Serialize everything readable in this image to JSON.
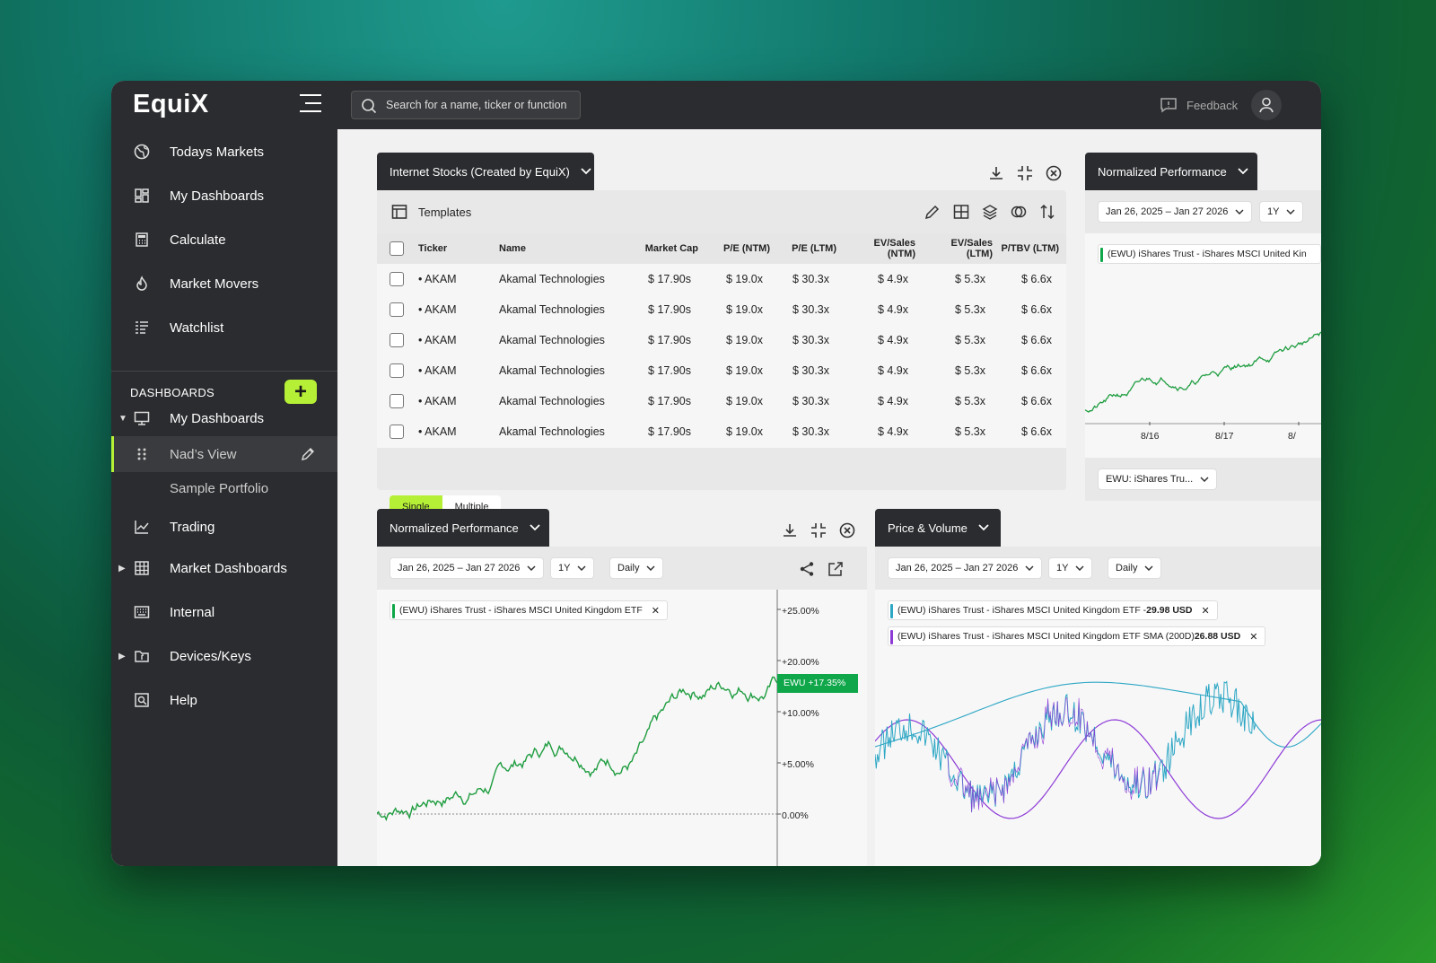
{
  "app": {
    "logo": "EquiX"
  },
  "sidebar": {
    "nav": [
      {
        "label": "Todays Markets",
        "icon": "globe-icon"
      },
      {
        "label": "My Dashboards",
        "icon": "dashboard-grid-icon"
      },
      {
        "label": "Calculate",
        "icon": "calculator-icon"
      },
      {
        "label": "Market Movers",
        "icon": "flame-icon"
      },
      {
        "label": "Watchlist",
        "icon": "list-icon"
      }
    ],
    "dashboards_label": "DASHBOARDS",
    "add_label": "+",
    "dash_items": [
      {
        "label": "My Dashboards"
      },
      {
        "label": "Nad’s View"
      },
      {
        "label": "Sample Portfolio"
      },
      {
        "label": "Trading"
      },
      {
        "label": "Market Dashboards"
      },
      {
        "label": "Internal"
      },
      {
        "label": "Devices/Keys"
      },
      {
        "label": "Help"
      }
    ]
  },
  "topbar": {
    "search_placeholder": "Search for a name, ticker or function",
    "feedback": "Feedback"
  },
  "screener": {
    "title": "Internet Stocks (Created by EquiX)",
    "templates": "Templates",
    "columns": [
      "Ticker",
      "Name",
      "Market Cap",
      "P/E (NTM)",
      "P/E (LTM)",
      "EV/Sales (NTM)",
      "EV/Sales (LTM)",
      "P/TBV (LTM)"
    ],
    "rows": [
      [
        "• AKAM",
        "Akamal Technologies",
        "$ 17.90s",
        "$ 19.0x",
        "$ 30.3x",
        "$ 4.9x",
        "$ 5.3x",
        "$ 6.6x"
      ],
      [
        "• AKAM",
        "Akamal Technologies",
        "$ 17.90s",
        "$ 19.0x",
        "$ 30.3x",
        "$ 4.9x",
        "$ 5.3x",
        "$ 6.6x"
      ],
      [
        "• AKAM",
        "Akamal Technologies",
        "$ 17.90s",
        "$ 19.0x",
        "$ 30.3x",
        "$ 4.9x",
        "$ 5.3x",
        "$ 6.6x"
      ],
      [
        "• AKAM",
        "Akamal Technologies",
        "$ 17.90s",
        "$ 19.0x",
        "$ 30.3x",
        "$ 4.9x",
        "$ 5.3x",
        "$ 6.6x"
      ],
      [
        "• AKAM",
        "Akamal Technologies",
        "$ 17.90s",
        "$ 19.0x",
        "$ 30.3x",
        "$ 4.9x",
        "$ 5.3x",
        "$ 6.6x"
      ],
      [
        "• AKAM",
        "Akamal Technologies",
        "$ 17.90s",
        "$ 19.0x",
        "$ 30.3x",
        "$ 4.9x",
        "$ 5.3x",
        "$ 6.6x"
      ]
    ],
    "seg_single": "Single",
    "seg_multiple": "Multiple"
  },
  "norm_right": {
    "title": "Normalized Performance",
    "date_range": "Jan 26, 2025 – Jan 27 2026",
    "period": "1Y",
    "legend": "(EWU) iShares Trust - iShares MSCI United Kin",
    "x_ticks": [
      "8/16",
      "8/17",
      "8/"
    ],
    "selector": "EWU: iShares Tru..."
  },
  "norm_main": {
    "title": "Normalized Performance",
    "date_range": "Jan 26, 2025 – Jan 27 2026",
    "period": "1Y",
    "interval": "Daily",
    "legend": "(EWU) iShares Trust - iShares MSCI United Kingdom ETF",
    "y_ticks": [
      "+25.00%",
      "+20.00%",
      "+10.00%",
      "+5.00%",
      "0.00%"
    ],
    "last_label": "EWU +17.35%",
    "line_color": "#1f9d3f"
  },
  "price_volume": {
    "title": "Price & Volume",
    "date_range": "Jan 26, 2025 – Jan 27 2026",
    "period": "1Y",
    "interval": "Daily",
    "legend1_prefix": "(EWU) iShares Trust - iShares MSCI United Kingdom ETF - ",
    "legend1_value": "29.98 USD",
    "legend2_prefix": "(EWU) iShares Trust - iShares MSCI United Kingdom ETF  SMA (200D) ",
    "legend2_value": "26.88 USD",
    "color_price": "#2ea7c4",
    "color_sma": "#8e3bd6"
  },
  "colors": {
    "accent": "#b6f036",
    "dark": "#2b2c2f",
    "green": "#0fa74a"
  }
}
